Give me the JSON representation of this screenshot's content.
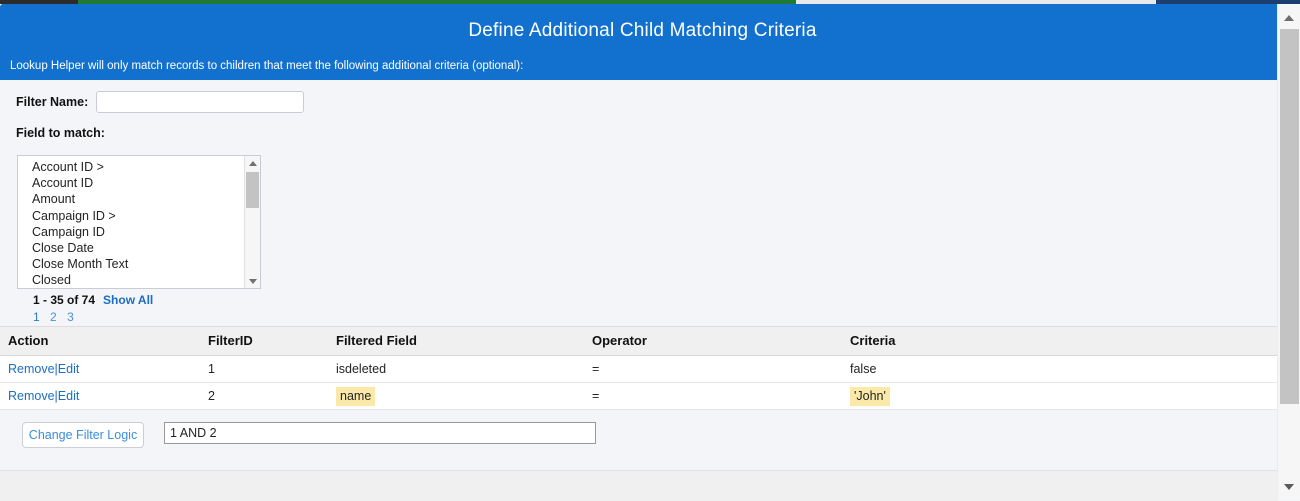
{
  "window": {
    "header_bg": "#1271ce",
    "page_bg": "#f4f5f9",
    "highlight_color": "#fae9a8",
    "link_color": "#1b6ec2"
  },
  "header": {
    "title": "Define Additional Child Matching Criteria",
    "subtitle": "Lookup Helper will only match records to children that meet the following additional criteria (optional):"
  },
  "form": {
    "filter_name_label": "Filter Name:",
    "filter_name_value": "",
    "filter_name_placeholder": "",
    "field_to_match_label": "Field to match:"
  },
  "field_list": {
    "items": [
      "Account ID >",
      "Account ID",
      "Amount",
      "Campaign ID >",
      "Campaign ID",
      "Close Date",
      "Close Month Text",
      "Closed"
    ],
    "scroll_up_icon": "triangle-up-icon",
    "scroll_down_icon": "triangle-down-icon"
  },
  "pagination": {
    "count_text": "1 - 35 of 74",
    "show_all_label": "Show All",
    "pages": [
      "1",
      "2",
      "3"
    ],
    "current_page": "1"
  },
  "table": {
    "headers": [
      "Action",
      "FilterID",
      "Filtered Field",
      "Operator",
      "Criteria"
    ],
    "rows": [
      {
        "remove_label": "Remove",
        "separator": "|",
        "edit_label": "Edit",
        "filter_id": "1",
        "filtered_field": "isdeleted",
        "filtered_field_highlighted": false,
        "operator": "=",
        "criteria": "false",
        "criteria_highlighted": false
      },
      {
        "remove_label": "Remove",
        "separator": "|",
        "edit_label": "Edit",
        "filter_id": "2",
        "filtered_field": "name",
        "filtered_field_highlighted": true,
        "operator": "=",
        "criteria": "'John'",
        "criteria_highlighted": true
      }
    ]
  },
  "filter_logic": {
    "button_label": "Change Filter Logic",
    "expression_value": "1 AND 2",
    "expression_placeholder": ""
  },
  "scrollbar": {
    "up_icon": "scroll-up-arrow-icon",
    "down_icon": "scroll-down-arrow-icon"
  }
}
